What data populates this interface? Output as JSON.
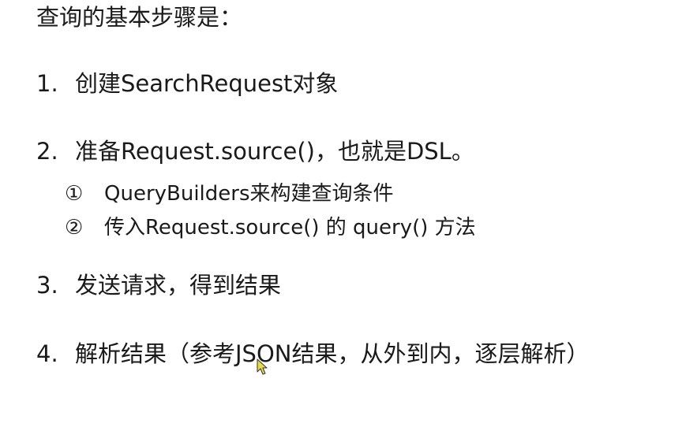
{
  "title": "查询的基本步骤是：",
  "steps": [
    {
      "num": "1.",
      "text": "创建SearchRequest对象"
    },
    {
      "num": "2.",
      "text": "准备Request.source()，也就是DSL。"
    },
    {
      "num": "3.",
      "text": "发送请求，得到结果"
    },
    {
      "num": "4.",
      "text": "解析结果（参考JSON结果，从外到内，逐层解析）"
    }
  ],
  "substeps": [
    {
      "mark": "①",
      "text": "QueryBuilders来构建查询条件"
    },
    {
      "mark": "②",
      "text": "传入Request.source() 的 query() 方法"
    }
  ],
  "colors": {
    "text": "#1a1a1a",
    "background": "#ffffff",
    "cursor": "#e8d84a"
  }
}
